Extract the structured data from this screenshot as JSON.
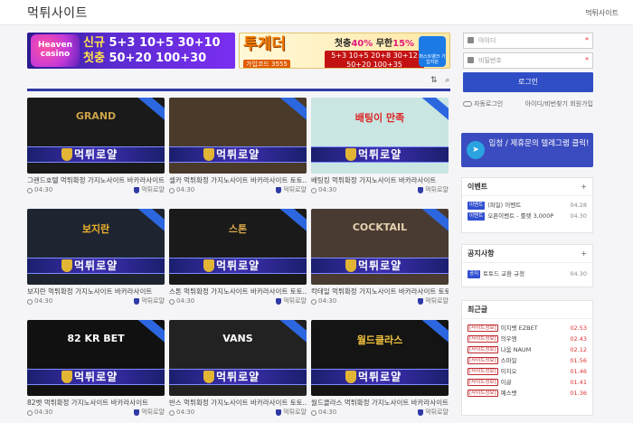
{
  "header": {
    "site_title": "먹튀사이트",
    "top_link": "먹튀사이트"
  },
  "banners": {
    "b1": {
      "logo": "Heaven casino",
      "line1_a": "신규",
      "line1_b": "5+3 10+5 30+10",
      "line2_a": "첫충",
      "line2_b": "50+20 100+30"
    },
    "b2": {
      "logo": "투게더",
      "code": "가입코드 3555",
      "r1_a": "첫충",
      "r1_b": "40%",
      "r1_c": "무한",
      "r1_d": "15%",
      "r2": "5+3 10+5 20+8 30+12 50+20 100+35",
      "app": "퍼스트뱅크 가입지원"
    }
  },
  "toolbar": {
    "sort_icon": "sort-icon",
    "search_icon": "search-icon"
  },
  "cards": [
    {
      "title": "그랜드호텔 먹튀확정 가지노사이트 바카라사이트",
      "author": "먹튀로얄",
      "time": "04:30",
      "art": "GRAND",
      "bg": "#1a1a1a",
      "artColor": "#caa24a"
    },
    {
      "title": "셀카 먹튀확정 가지노사이트 바카라사이트 토토...",
      "author": "먹튀로얄",
      "time": "04:30",
      "art": "",
      "bg": "#4a3a2a",
      "artColor": "#fff"
    },
    {
      "title": "배팅킹 먹튀확정 가지노사이트 바카라사이트",
      "author": "먹튀로얄",
      "time": "04:30",
      "art": "배팅이 만족",
      "bg": "#c9e6e2",
      "artColor": "#d22"
    },
    {
      "title": "보지란 먹튀확정 가지노사이트 바카라사이트",
      "author": "먹튀로얄",
      "time": "04:30",
      "art": "보지란",
      "bg": "#1e2430",
      "artColor": "#f0b32a"
    },
    {
      "title": "스톤 먹튀확정 가지노사이트 바카라사이트 토토...",
      "author": "먹튀로얄",
      "time": "04:30",
      "art": "스톤",
      "bg": "#1a1a1a",
      "artColor": "#d9a84a"
    },
    {
      "title": "칵테일 먹튀확정 가지노사이트 바카라사이트 토토...",
      "author": "먹튀로얄",
      "time": "04:30",
      "art": "COCKTAIL",
      "bg": "#4a3b32",
      "artColor": "#e6d2b0"
    },
    {
      "title": "82벳 먹튀확정 가지노사이트 바카라사이트",
      "author": "먹튀로얄",
      "time": "04:30",
      "art": "82 KR BET",
      "bg": "#111",
      "artColor": "#fff"
    },
    {
      "title": "반스 먹튀확정 가지노사이트 바카라사이트 토토...",
      "author": "먹튀로얄",
      "time": "04:30",
      "art": "VANS",
      "bg": "#222",
      "artColor": "#fff"
    },
    {
      "title": "월드클라스 먹튀확정 가지노사이트 바카라사이트",
      "author": "먹튀로얄",
      "time": "04:30",
      "art": "월드클라스",
      "bg": "#141414",
      "artColor": "#f2c23c"
    }
  ],
  "login": {
    "id_placeholder": "아이디",
    "pw_placeholder": "비밀번호",
    "req": "*",
    "button": "로그인",
    "auto_login": "자동로그인",
    "find": "아이디/비번찾기 회원가입"
  },
  "telegram": {
    "text": "입청 / 제휴문의 텔레그램 클릭!"
  },
  "event": {
    "title": "이벤트",
    "more": "+",
    "rows": [
      {
        "tag": "이벤트",
        "text": "(파일) 이벤트",
        "date": "04.28"
      },
      {
        "tag": "이벤트",
        "text": "오픈이벤트 - 룰렛 3,000P",
        "date": "04.30"
      }
    ]
  },
  "notice": {
    "title": "공지사항",
    "more": "+",
    "rows": [
      {
        "tag": "공지",
        "text": "토토드 교환 규정",
        "date": "04.30"
      }
    ]
  },
  "recent": {
    "title": "최근글",
    "rows": [
      {
        "tag": "[사이트정보]",
        "text": "이지벳 EZBET",
        "date": "02.53"
      },
      {
        "tag": "[사이트정보]",
        "text": "의우엔",
        "date": "02.43"
      },
      {
        "tag": "[사이트정보]",
        "text": "나움 NAUM",
        "date": "02.12"
      },
      {
        "tag": "[사이트정보]",
        "text": "스마일",
        "date": "01.56"
      },
      {
        "tag": "[사이트정보]",
        "text": "이지오",
        "date": "01.46"
      },
      {
        "tag": "[사이트정보]",
        "text": "이글",
        "date": "01.41"
      },
      {
        "tag": "[사이트정보]",
        "text": "예스벳",
        "date": "01.36"
      }
    ]
  }
}
